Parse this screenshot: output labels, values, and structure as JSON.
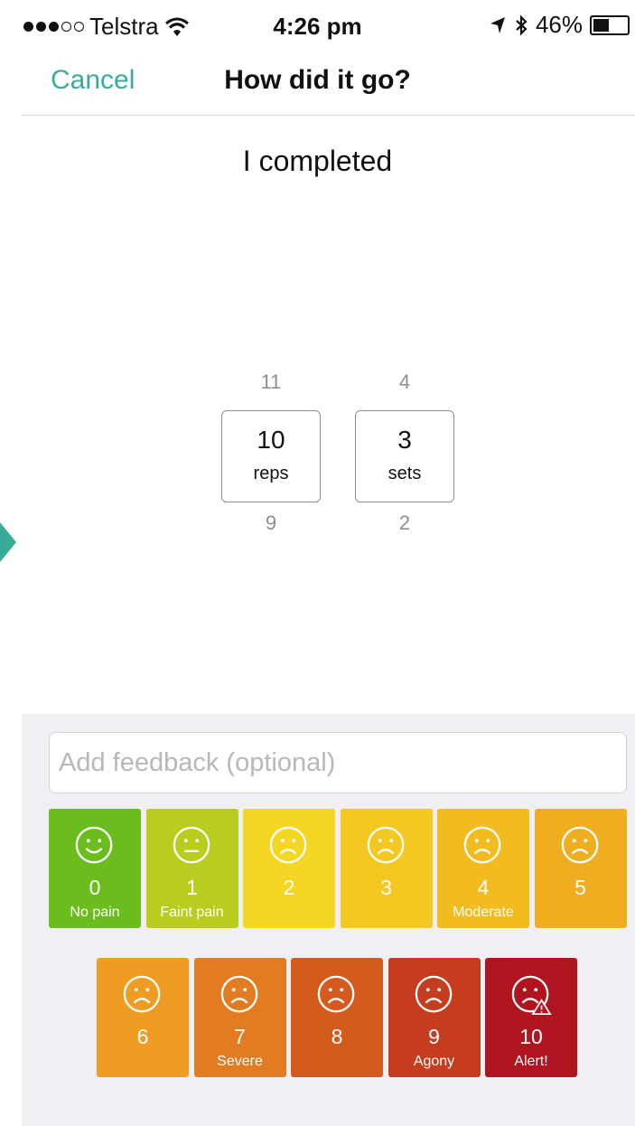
{
  "status_bar": {
    "carrier": "Telstra",
    "time": "4:26 pm",
    "battery_percent": "46%",
    "battery_level": 0.46,
    "icons": [
      "signal-dots-icon",
      "wifi-icon",
      "location-arrow-icon",
      "bluetooth-icon",
      "battery-icon"
    ]
  },
  "nav": {
    "cancel_label": "Cancel",
    "title": "How did it go?"
  },
  "completed_label": "I completed",
  "pickers": {
    "reps": {
      "above": "11",
      "value": "10",
      "unit": "reps",
      "below": "9"
    },
    "sets": {
      "above": "4",
      "value": "3",
      "unit": "sets",
      "below": "2"
    }
  },
  "feedback": {
    "placeholder": "Add feedback (optional)",
    "value": ""
  },
  "pain_scale": [
    {
      "num": "0",
      "label": "No pain",
      "color": "#6bbd1e",
      "face": "smile"
    },
    {
      "num": "1",
      "label": "Faint pain",
      "color": "#b8cd1e",
      "face": "neutral"
    },
    {
      "num": "2",
      "label": "",
      "color": "#f5d622",
      "face": "frown"
    },
    {
      "num": "3",
      "label": "",
      "color": "#f4c820",
      "face": "frown"
    },
    {
      "num": "4",
      "label": "Moderate",
      "color": "#f2bb20",
      "face": "frown"
    },
    {
      "num": "5",
      "label": "",
      "color": "#efae20",
      "face": "frown"
    },
    {
      "num": "6",
      "label": "",
      "color": "#ee9c22",
      "face": "frown"
    },
    {
      "num": "7",
      "label": "Severe",
      "color": "#e27c22",
      "face": "frown"
    },
    {
      "num": "8",
      "label": "",
      "color": "#d45a1e",
      "face": "frown"
    },
    {
      "num": "9",
      "label": "Agony",
      "color": "#c63c1e",
      "face": "frown"
    },
    {
      "num": "10",
      "label": "Alert!",
      "color": "#b0141e",
      "face": "alert"
    }
  ],
  "colors": {
    "accent": "#3aab9a",
    "panel_bg": "#efeff4"
  }
}
